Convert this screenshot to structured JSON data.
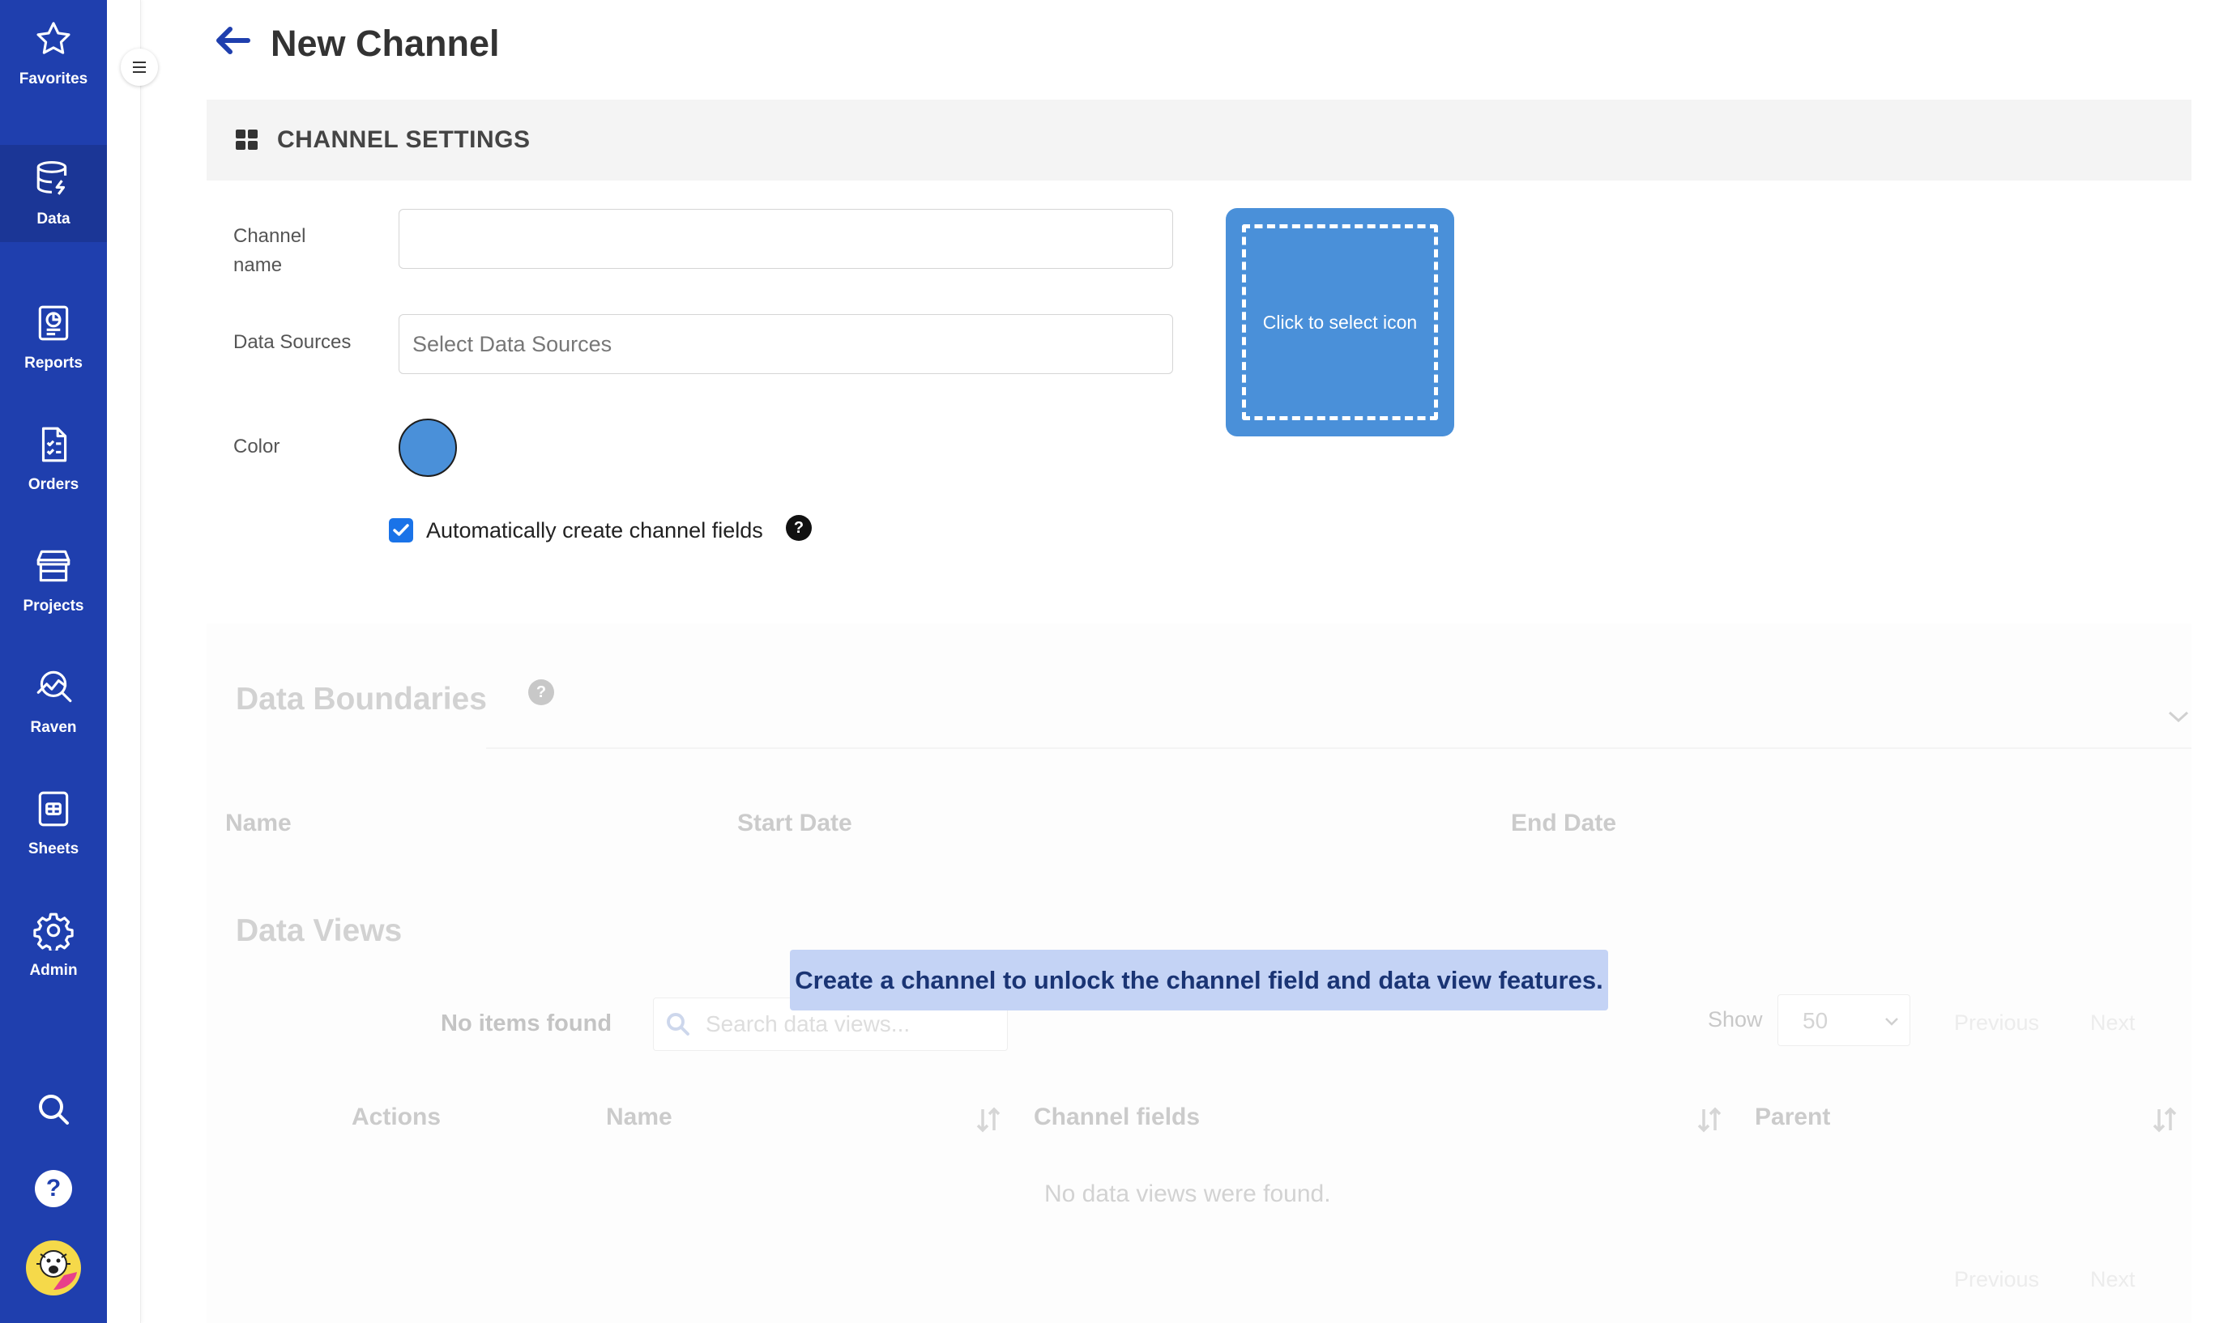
{
  "sidebar": {
    "items": [
      {
        "label": "Favorites",
        "icon": "star-icon"
      },
      {
        "label": "Data",
        "icon": "database-icon"
      },
      {
        "label": "Reports",
        "icon": "report-icon"
      },
      {
        "label": "Orders",
        "icon": "orders-icon"
      },
      {
        "label": "Projects",
        "icon": "store-icon"
      },
      {
        "label": "Raven",
        "icon": "raven-chart-icon"
      },
      {
        "label": "Sheets",
        "icon": "sheet-icon"
      },
      {
        "label": "Admin",
        "icon": "gear-icon"
      }
    ],
    "active": "Data",
    "bottom": [
      "search-icon",
      "help-icon",
      "user-avatar"
    ]
  },
  "header": {
    "title": "New Channel"
  },
  "settings": {
    "section_title": "CHANNEL SETTINGS",
    "channel_name_label": "Channel name",
    "channel_name_value": "",
    "data_sources_label": "Data Sources",
    "data_sources_placeholder": "Select Data Sources",
    "color_label": "Color",
    "color_value": "#4a90d9",
    "auto_create_label": "Automatically create channel fields",
    "auto_create_checked": true,
    "icon_picker_text": "Click to select icon"
  },
  "boundaries": {
    "title": "Data Boundaries",
    "columns": [
      "Name",
      "Start Date",
      "End Date"
    ]
  },
  "data_views": {
    "title": "Data Views",
    "no_items": "No items found",
    "search_placeholder": "Search data views...",
    "show_label": "Show",
    "show_value": "50",
    "previous": "Previous",
    "next": "Next",
    "columns": [
      "Actions",
      "Name",
      "Channel fields",
      "Parent"
    ],
    "empty_message": "No data views were found."
  },
  "notice": "Create a channel to unlock the channel field and data view features.",
  "colors": {
    "sidebar": "#1f3fae",
    "accent": "#1a73e8",
    "swatch": "#4a90d9",
    "notice_bg": "#c4d3f5"
  }
}
